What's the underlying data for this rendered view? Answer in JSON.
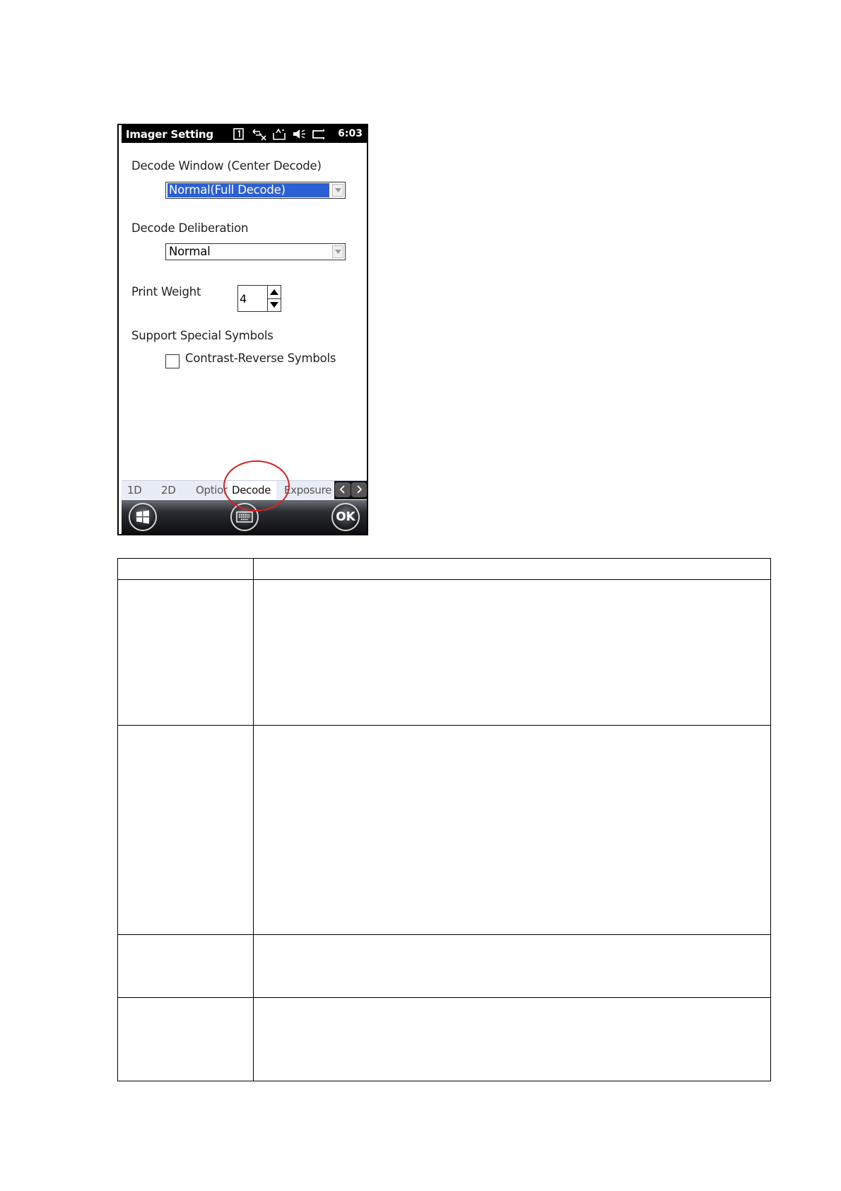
{
  "status_bar": {
    "title": "Imager Setting",
    "time": "6:03",
    "icons": [
      "sim-card-icon",
      "sync-disconnected-icon",
      "data-connection-icon",
      "volume-icon",
      "battery-icon"
    ]
  },
  "decode_window": {
    "label": "Decode Window (Center Decode)",
    "value": "Normal(Full Decode)"
  },
  "decode_deliberation": {
    "label": "Decode Deliberation",
    "value": "Normal"
  },
  "print_weight": {
    "label": "Print Weight",
    "value": "4"
  },
  "special_symbols": {
    "label": "Support Special Symbols",
    "checkbox_label": "Contrast-Reverse Symbols",
    "checked": false
  },
  "tabs": [
    {
      "label": "1D"
    },
    {
      "label": "2D"
    },
    {
      "label": "Option"
    },
    {
      "label": "Decode",
      "active": true
    },
    {
      "label": "Exposure"
    }
  ],
  "bottom_bar": {
    "ok_label": "OK"
  },
  "colors": {
    "selection": "#2a5fd6",
    "highlight_circle": "#d92020",
    "status_bar_bg": "#000000"
  },
  "table": {
    "rows": [
      {
        "col1": "",
        "col2": ""
      },
      {
        "col1": "",
        "col2": ""
      },
      {
        "col1": "",
        "col2": ""
      },
      {
        "col1": "",
        "col2": ""
      },
      {
        "col1": "",
        "col2": ""
      }
    ]
  }
}
